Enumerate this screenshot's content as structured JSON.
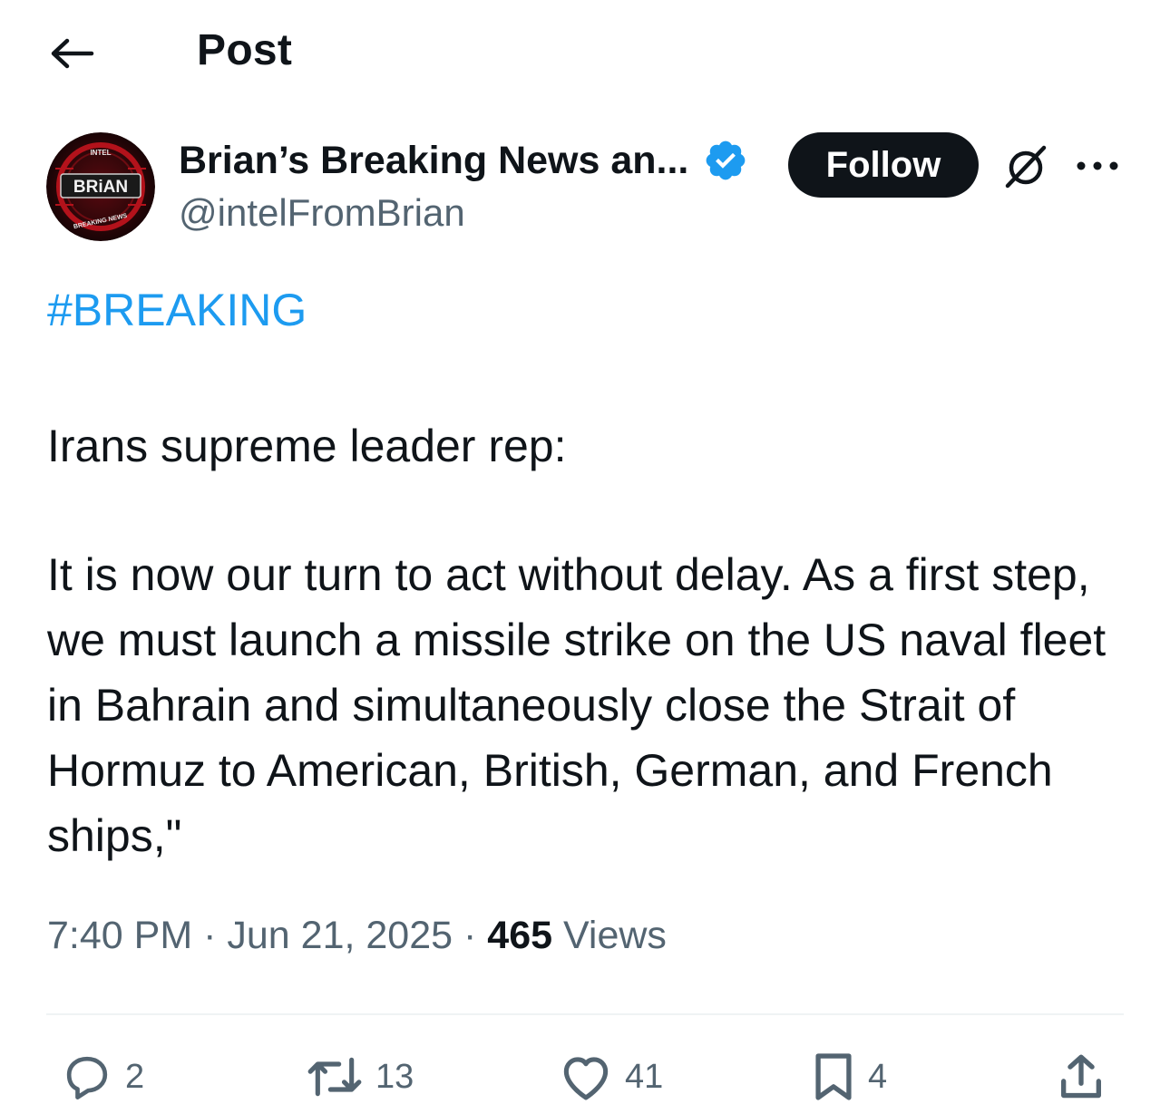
{
  "header": {
    "back_icon": "arrow-left-icon",
    "title": "Post"
  },
  "author": {
    "avatar": {
      "icon": "brian-breaking-news-logo",
      "logo_text": "BRiAN",
      "logo_ring_top": "INTEL",
      "logo_ring_bottom": "BREAKING NEWS"
    },
    "display_name": "Brian’s Breaking News an...",
    "verified_icon": "verified-badge-icon",
    "handle": "@intelFromBrian",
    "follow_label": "Follow",
    "grok_icon": "grok-icon",
    "more_icon": "more-options-icon"
  },
  "post": {
    "hashtag": "#BREAKING",
    "intro": "Irans supreme leader rep:",
    "quote": "It is now our turn to act without delay. As a first step, we must launch a missile strike on the US naval fleet in Bahrain and simultaneously close the Strait of Hormuz to American, British, German, and French ships,\""
  },
  "meta": {
    "time": "7:40 PM",
    "separator": "·",
    "date": "Jun 21, 2025",
    "views_count": "465",
    "views_label": "Views"
  },
  "actions": {
    "reply": {
      "icon": "reply-icon",
      "count": "2"
    },
    "repost": {
      "icon": "repost-icon",
      "count": "13"
    },
    "like": {
      "icon": "heart-icon",
      "count": "41"
    },
    "bookmark": {
      "icon": "bookmark-icon",
      "count": "4"
    },
    "share": {
      "icon": "share-icon"
    }
  },
  "colors": {
    "accent": "#1d9bf0",
    "text_primary": "#0f1419",
    "text_secondary": "#536471",
    "divider": "#eff3f4",
    "verified": "#1d9bf0",
    "avatar_red": "#b3121b"
  }
}
